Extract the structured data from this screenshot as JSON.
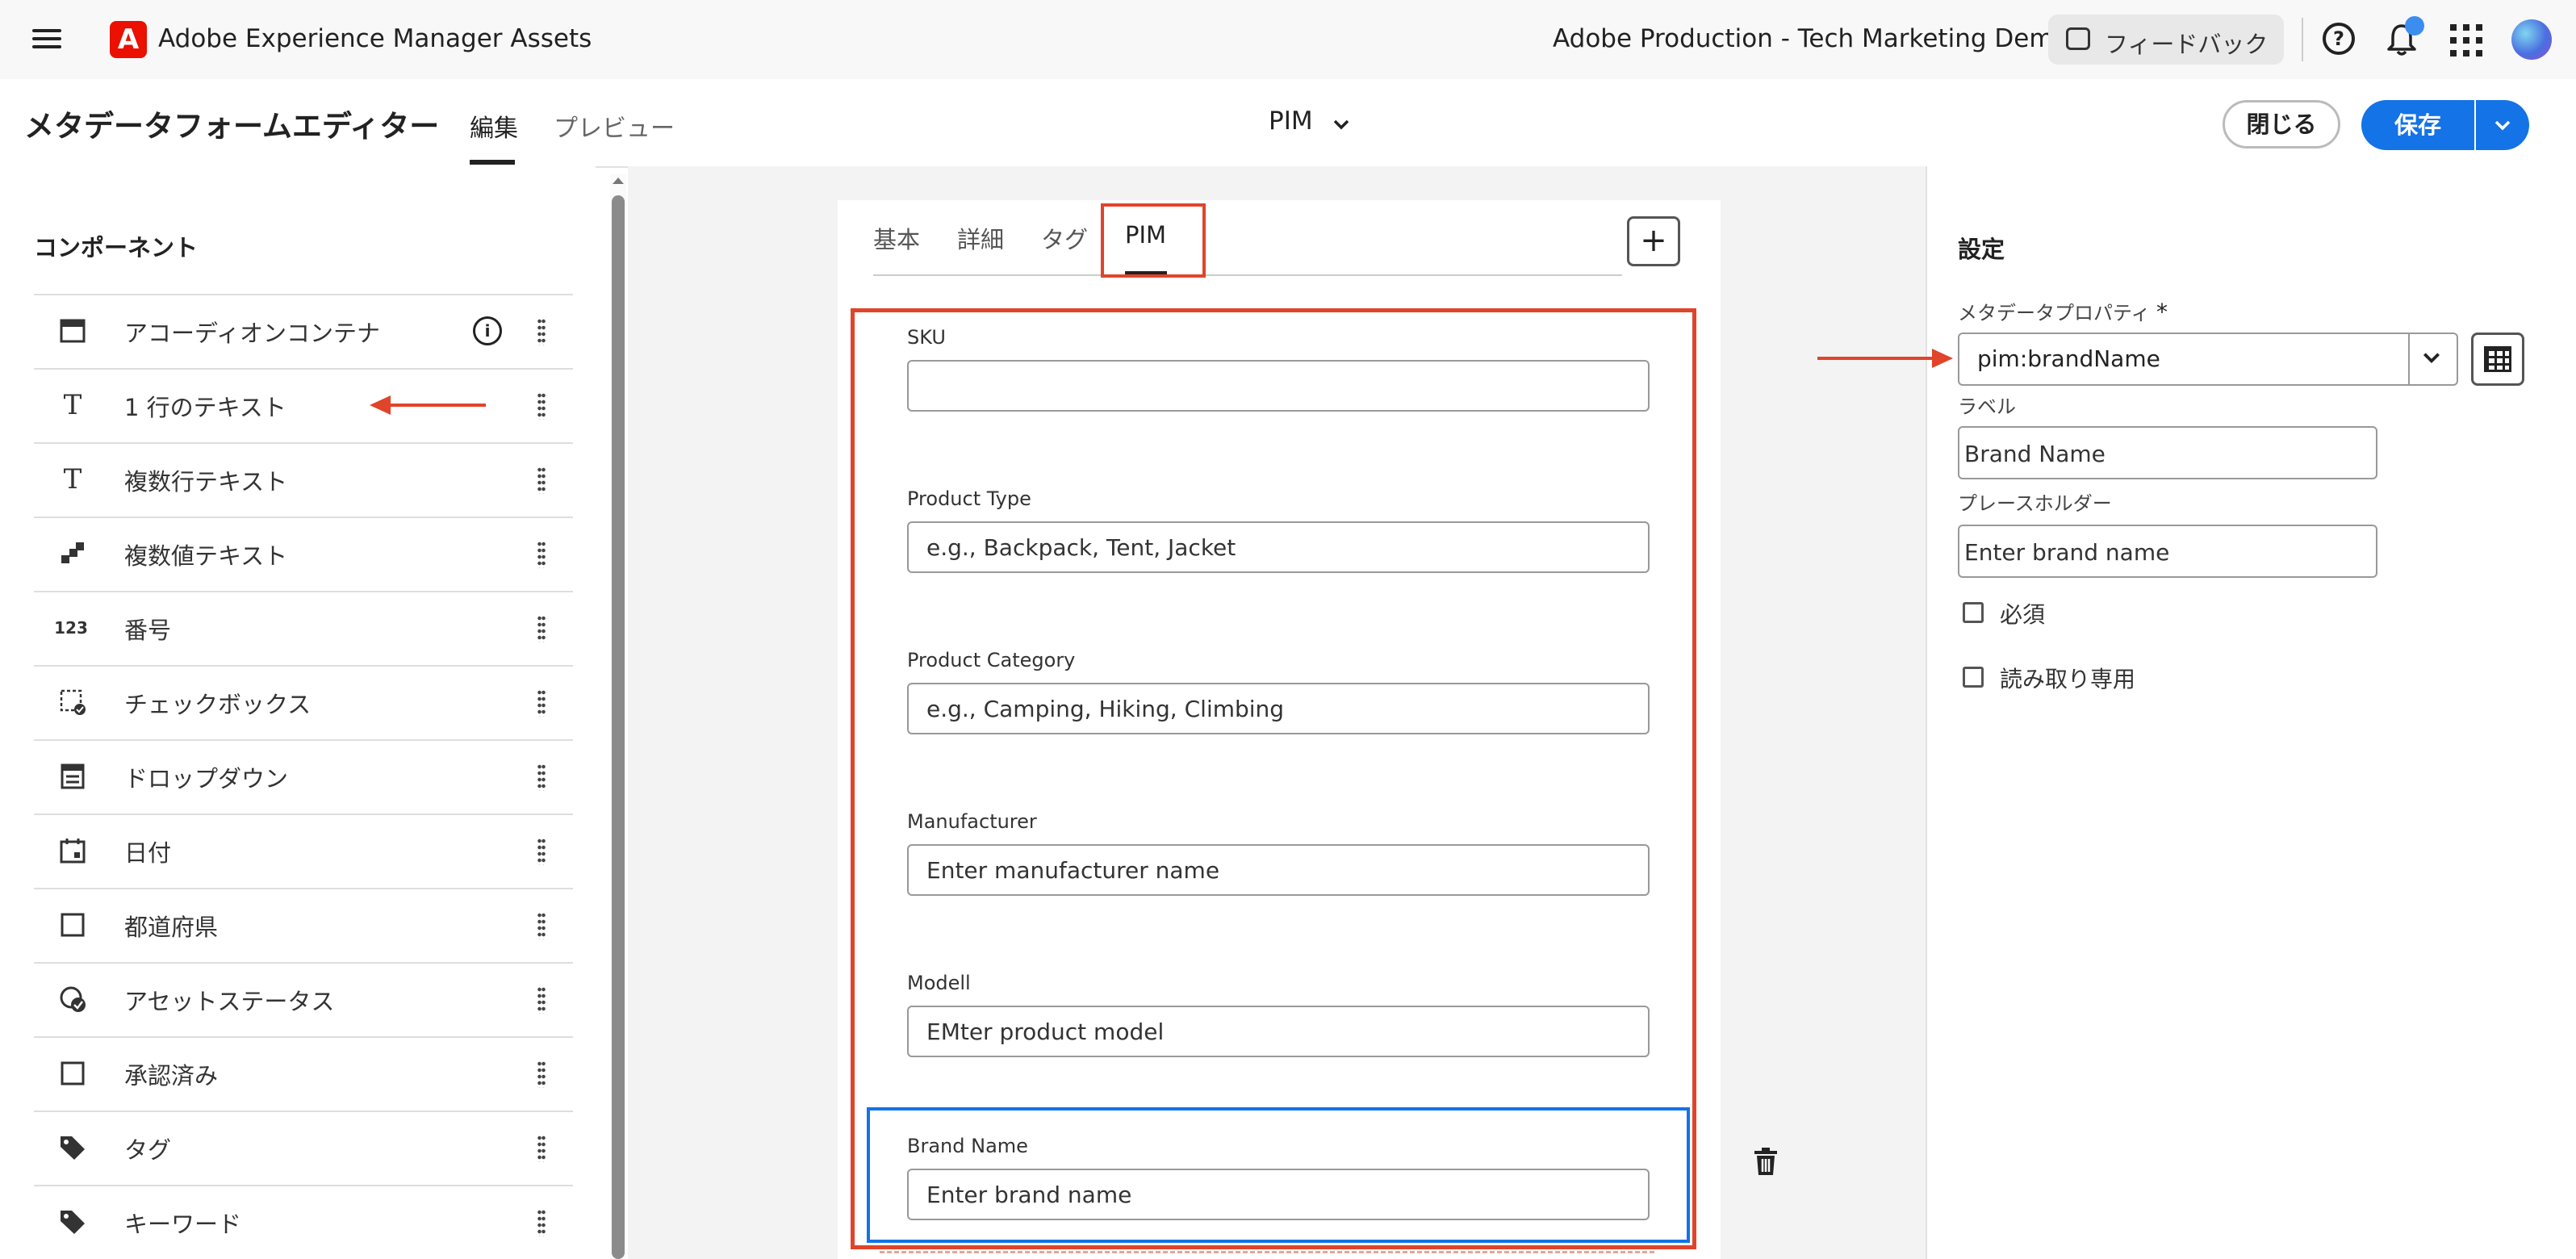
{
  "topbar": {
    "app_title": "Adobe Experience Manager Assets",
    "org_name": "Adobe Production - Tech Marketing Demos",
    "feedback_label": "フィードバック",
    "help_icon": "?"
  },
  "header": {
    "page_title": "メタデータフォームエディター",
    "tabs": {
      "edit": "編集",
      "preview": "プレビュー"
    },
    "form_selector": "PIM",
    "close_label": "閉じる",
    "save_label": "保存"
  },
  "components": {
    "heading": "コンポーネント",
    "items": [
      {
        "label": "アコーディオンコンテナ",
        "icon": "accordion-icon"
      },
      {
        "label": "1 行のテキスト",
        "icon": "text-icon",
        "glyph": "T"
      },
      {
        "label": "複数行テキスト",
        "icon": "text-icon",
        "glyph": "T"
      },
      {
        "label": "複数値テキスト",
        "icon": "multi-value-icon"
      },
      {
        "label": "番号",
        "icon": "number-icon",
        "glyph": "123"
      },
      {
        "label": "チェックボックス",
        "icon": "checkbox-icon"
      },
      {
        "label": "ドロップダウン",
        "icon": "dropdown-icon"
      },
      {
        "label": "日付",
        "icon": "calendar-icon"
      },
      {
        "label": "都道府県",
        "icon": "square-icon"
      },
      {
        "label": "アセットステータス",
        "icon": "status-icon"
      },
      {
        "label": "承認済み",
        "icon": "square-icon"
      },
      {
        "label": "タグ",
        "icon": "tag-icon"
      },
      {
        "label": "キーワード",
        "icon": "tag-icon"
      }
    ]
  },
  "form": {
    "tabs": [
      "基本",
      "詳細",
      "タグ",
      "PIM"
    ],
    "active_tab": "PIM",
    "add_tab": "+",
    "fields": [
      {
        "label": "SKU",
        "placeholder": ""
      },
      {
        "label": "Product Type",
        "placeholder": "e.g., Backpack, Tent, Jacket"
      },
      {
        "label": "Product Category",
        "placeholder": "e.g., Camping, Hiking, Climbing"
      },
      {
        "label": "Manufacturer",
        "placeholder": "Enter manufacturer name"
      },
      {
        "label": "Modell",
        "placeholder": "EMter product model"
      },
      {
        "label": "Brand Name",
        "placeholder": "Enter brand name"
      }
    ]
  },
  "settings": {
    "heading": "設定",
    "property_label": "メタデータプロパティ",
    "required_marker": "*",
    "property_value": "pim:brandName",
    "label_label": "ラベル",
    "label_value": "Brand Name",
    "placeholder_label": "プレースホルダー",
    "placeholder_value": "Enter brand name",
    "required_checkbox": "必須",
    "readonly_checkbox": "読み取り専用"
  },
  "colors": {
    "accent": "#1473e6",
    "annotation": "#e0442a",
    "adobe_red": "#eb1000"
  }
}
